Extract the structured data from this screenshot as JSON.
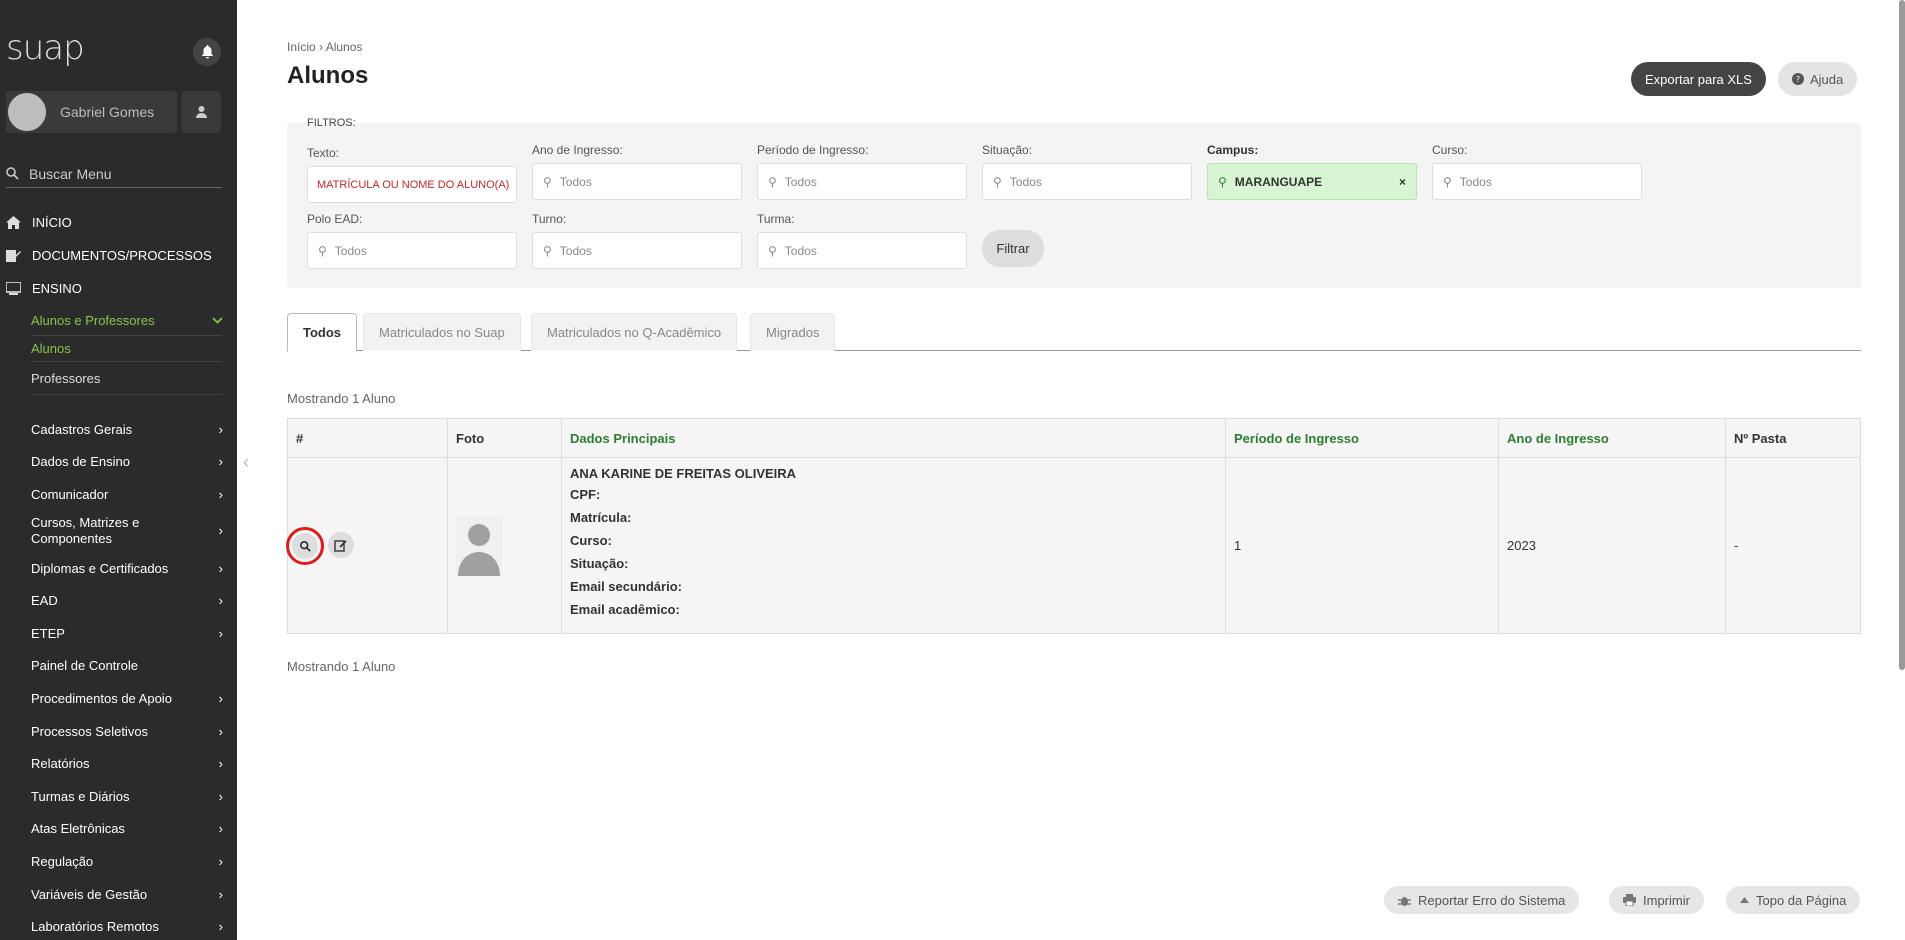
{
  "sidebar": {
    "logo": "suap",
    "user_name": "Gabriel Gomes",
    "search_placeholder": "Buscar Menu",
    "top_items": [
      {
        "label": "INÍCIO",
        "icon": "home-icon"
      },
      {
        "label": "DOCUMENTOS/PROCESSOS",
        "icon": "document-edit-icon"
      },
      {
        "label": "ENSINO",
        "icon": "chalkboard-icon"
      }
    ],
    "ensino_group": "Alunos e Professores",
    "ensino_sub": [
      "Alunos",
      "Professores"
    ],
    "menu": [
      "Cadastros Gerais",
      "Dados de Ensino",
      "Comunicador",
      "Cursos, Matrizes e Componentes",
      "Diplomas e Certificados",
      "EAD",
      "ETEP",
      "Painel de Controle",
      "Procedimentos de Apoio",
      "Processos Seletivos",
      "Relatórios",
      "Turmas e Diários",
      "Atas Eletrônicas",
      "Regulação",
      "Variáveis de Gestão",
      "Laboratórios Remotos"
    ]
  },
  "header": {
    "breadcrumb_home": "Início",
    "breadcrumb_sep": "›",
    "breadcrumb_current": "Alunos",
    "title": "Alunos",
    "export_label": "Exportar para XLS",
    "help_label": "Ajuda"
  },
  "filters": {
    "title": "FILTROS:",
    "texto_label": "Texto:",
    "texto_placeholder": "MATRÍCULA OU NOME DO ALUNO(A)",
    "ano_label": "Ano de Ingresso:",
    "periodo_label": "Período de Ingresso:",
    "situacao_label": "Situação:",
    "campus_label": "Campus:",
    "campus_value": "MARANGUAPE",
    "campus_clear": "×",
    "curso_label": "Curso:",
    "polo_label": "Polo EAD:",
    "turno_label": "Turno:",
    "turma_label": "Turma:",
    "todos": "Todos",
    "filter_button": "Filtrar"
  },
  "tabs": [
    "Todos",
    "Matriculados no Suap",
    "Matriculados no Q-Acadêmico",
    "Migrados"
  ],
  "results": {
    "showing": "Mostrando 1 Aluno",
    "columns": [
      "#",
      "Foto",
      "Dados Principais",
      "Período de Ingresso",
      "Ano de Ingresso",
      "Nº Pasta"
    ],
    "row": {
      "name": "ANA KARINE DE FREITAS OLIVEIRA",
      "fields": [
        "CPF:",
        "Matrícula:",
        "Curso:",
        "Situação:",
        "Email secundário:",
        "Email acadêmico:"
      ],
      "periodo": "1",
      "ano": "2023",
      "pasta": "-"
    }
  },
  "footer": {
    "report_error": "Reportar Erro do Sistema",
    "print": "Imprimir",
    "top": "Topo da Página"
  }
}
